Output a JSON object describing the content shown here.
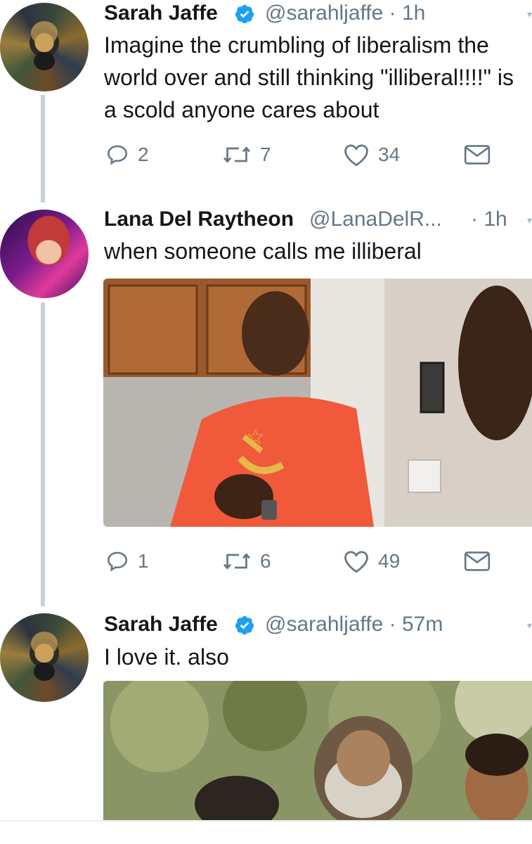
{
  "tweets": [
    {
      "name": "Sarah Jaffe",
      "verified": true,
      "handle": "@sarahljaffe",
      "time": "· 1h",
      "text": "Imagine the crumbling of liberalism the world over and still thinking \"illiberal!!!!\" is a scold anyone cares about",
      "replies": "2",
      "retweets": "7",
      "likes": "34"
    },
    {
      "name": "Lana Del Raytheon",
      "verified": false,
      "handle": "@LanaDelR...",
      "time": "· 1h",
      "text": "when someone calls me illiberal",
      "media": "photo",
      "replies": "1",
      "retweets": "6",
      "likes": "49"
    },
    {
      "name": "Sarah Jaffe",
      "verified": true,
      "handle": "@sarahljaffe",
      "time": "· 57m",
      "text": "I love it. also",
      "media": "photo"
    }
  ],
  "icons": {
    "reply": "reply-icon",
    "retweet": "retweet-icon",
    "like": "heart-icon",
    "dm": "envelope-icon",
    "verified": "verified-badge-icon",
    "more": "chevron-down-icon"
  },
  "colors": {
    "thread_line": "#c6d3de",
    "verified": "#1da1f2",
    "secondary_text": "#657786"
  }
}
